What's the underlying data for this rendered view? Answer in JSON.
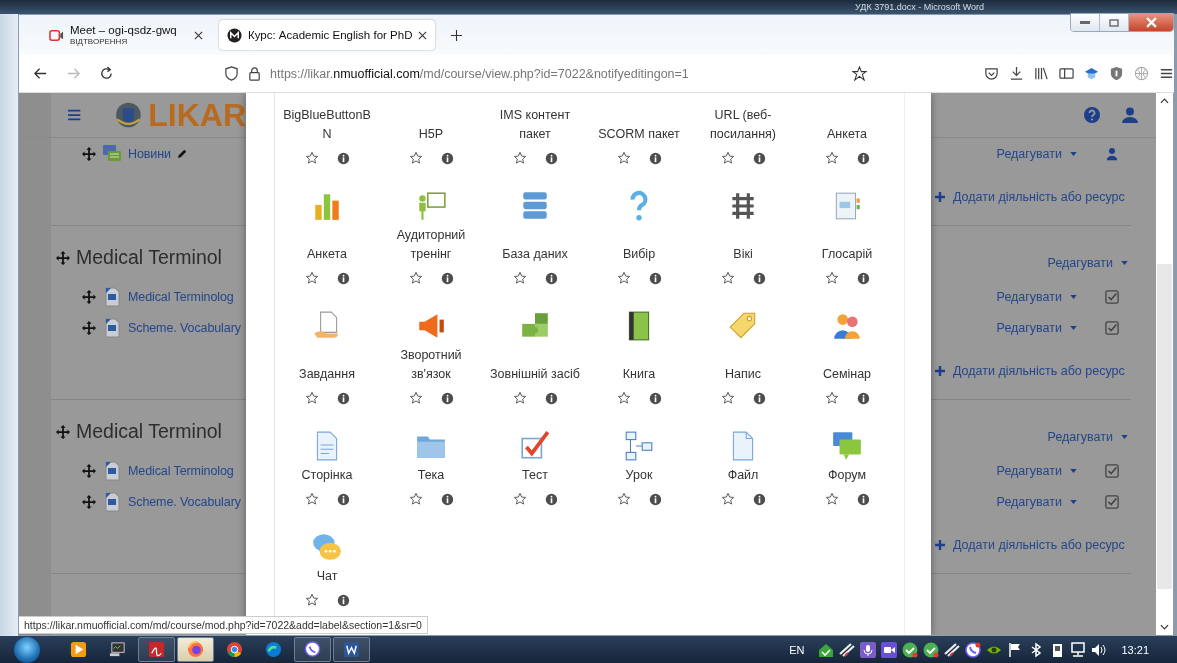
{
  "background_window": {
    "title": "УДК 3791.docx - Microsoft Word"
  },
  "browser": {
    "tabs": [
      {
        "title": "Meet – ogi-qsdz-gwq",
        "subtitle": "ВІДТВОРЕННЯ",
        "selected": false
      },
      {
        "title": "Курс: Academic English for PhD",
        "selected": true
      }
    ],
    "address": {
      "scheme_host": "https://likar.",
      "domain": "nmuofficial.com",
      "path": "/md/course/view.php?id=7022&notifyeditingon=1"
    },
    "status_url": "https://likar.nmuofficial.com/md/course/mod.php?id=7022&add=label&section=1&sr=0"
  },
  "site": {
    "logo": "LIKAR"
  },
  "sections": [
    {
      "activities": [
        {
          "kind": "forum",
          "name": "Новини",
          "edit": "Редагувати"
        }
      ],
      "add": "Додати діяльність або ресурс"
    },
    {
      "title": "Medical Terminol",
      "edit": "Редагувати",
      "activities": [
        {
          "kind": "file",
          "name": "Medical Terminolog",
          "edit": "Редагувати",
          "checked": true
        },
        {
          "kind": "file",
          "name": "Scheme. Vocabulary",
          "edit": "Редагувати",
          "checked": true
        }
      ],
      "add": "Додати діяльність або ресурс"
    },
    {
      "title": "Medical Terminol",
      "edit": "Редагувати",
      "activities": [
        {
          "kind": "file",
          "name": "Medical Terminolog",
          "edit": "Редагувати",
          "checked": true
        },
        {
          "kind": "file",
          "name": "Scheme. Vocabulary",
          "edit": "Редагувати",
          "checked": true
        }
      ],
      "add": "Додати діяльність або ресурс"
    }
  ],
  "chooser": {
    "items": [
      {
        "name": "BigBlueButtonB\nN",
        "starred": false
      },
      {
        "name": "H5P",
        "starred": false
      },
      {
        "name": "IMS контент пакет",
        "starred": false
      },
      {
        "name": "SCORM пакет",
        "starred": false
      },
      {
        "name": "URL (веб-посилання)",
        "starred": false
      },
      {
        "name": "Анкета",
        "starred": false
      },
      {
        "name": "Анкета",
        "kind": "feedback",
        "starred": false
      },
      {
        "name": "Аудиторний тренінг",
        "kind": "training",
        "starred": false
      },
      {
        "name": "База даних",
        "kind": "data",
        "starred": false
      },
      {
        "name": "Вибір",
        "kind": "choice",
        "starred": false
      },
      {
        "name": "Вікі",
        "kind": "wiki",
        "starred": false
      },
      {
        "name": "Глосарій",
        "kind": "glossary",
        "starred": false
      },
      {
        "name": "Завдання",
        "kind": "assign",
        "starred": false
      },
      {
        "name": "Зворотний зв'язок",
        "kind": "survey",
        "starred": false
      },
      {
        "name": "Зовнішній засіб",
        "kind": "lti",
        "starred": false
      },
      {
        "name": "Книга",
        "kind": "book",
        "starred": false
      },
      {
        "name": "Напис",
        "kind": "label",
        "starred": false
      },
      {
        "name": "Семінар",
        "kind": "workshop",
        "starred": false
      },
      {
        "name": "Сторінка",
        "kind": "page",
        "starred": false
      },
      {
        "name": "Тека",
        "kind": "folder",
        "starred": false
      },
      {
        "name": "Тест",
        "kind": "quiz",
        "starred": false
      },
      {
        "name": "Урок",
        "kind": "lesson",
        "starred": false
      },
      {
        "name": "Файл",
        "kind": "resource",
        "starred": false
      },
      {
        "name": "Форум",
        "kind": "forum",
        "starred": false
      },
      {
        "name": "Чат",
        "kind": "chat",
        "starred": false
      }
    ]
  },
  "taskbar": {
    "apps": [
      {
        "kind": "player",
        "running": false,
        "selected": false
      },
      {
        "kind": "monitor",
        "running": false,
        "selected": false
      },
      {
        "kind": "pdf",
        "running": true,
        "selected": false
      },
      {
        "kind": "firefox",
        "running": true,
        "selected": true
      },
      {
        "kind": "chrome",
        "running": false,
        "selected": false
      },
      {
        "kind": "edge",
        "running": false,
        "selected": false
      },
      {
        "kind": "viber",
        "running": true,
        "selected": false
      },
      {
        "kind": "word",
        "running": true,
        "selected": false
      }
    ],
    "language": "EN",
    "clock": "13:21"
  }
}
